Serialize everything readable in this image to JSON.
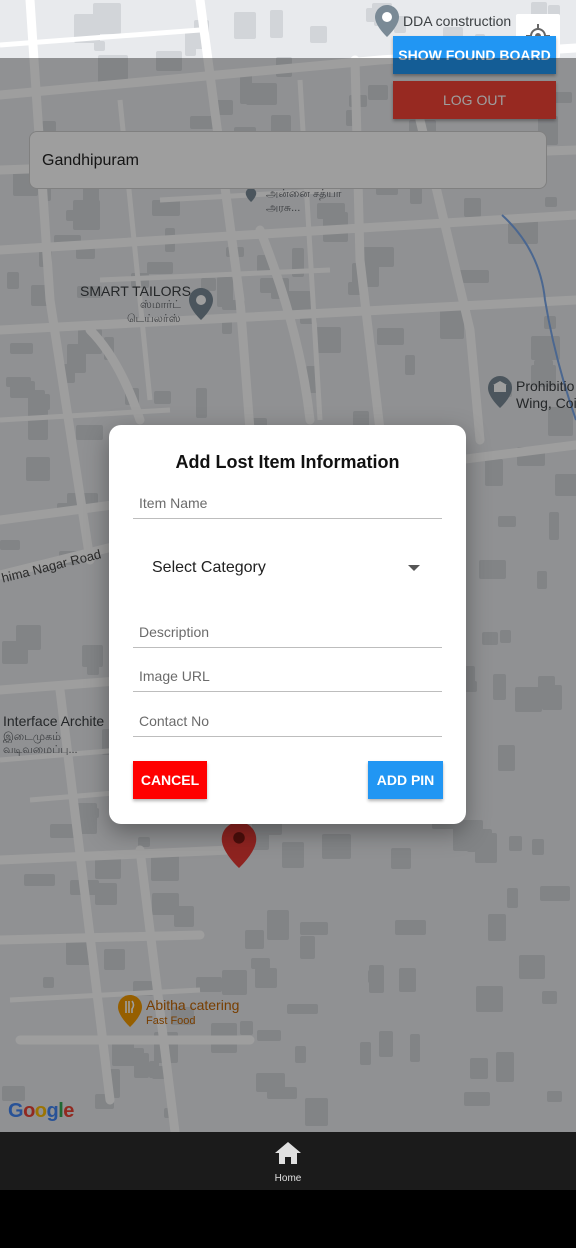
{
  "map": {
    "labels": {
      "dda": "DDA construction",
      "tamil_top": "அன்னை சத்யா",
      "tamil_top_sub": "அரசு...",
      "smart_tailors": "SMART TAILORS",
      "smart_tailors_tamil": "ஸ்மார்ட்",
      "smart_tailors_tamil2": "டெய்லர்ஸ்",
      "prohibition": "Prohibitio",
      "prohibition2": "Wing, Coi",
      "road": "hima Nagar Road",
      "interface": "Interface Archite",
      "interface_tamil": "இடைமுகம்",
      "interface_tamil2": "வடிவமைப்பு...",
      "abitha": "Abitha catering",
      "abitha_sub": "Fast Food"
    },
    "google_logo": [
      "G",
      "o",
      "o",
      "g",
      "l",
      "e"
    ],
    "logo_colors": [
      "#4285f4",
      "#ea4335",
      "#fbbc05",
      "#4285f4",
      "#34a853",
      "#ea4335"
    ]
  },
  "top_buttons": {
    "found_label": "SHOW FOUND BOARD",
    "logout_label": "LOG OUT"
  },
  "search": {
    "value": "Gandhipuram"
  },
  "dialog": {
    "title": "Add Lost Item Information",
    "item_name_placeholder": "Item Name",
    "category_label": "Select Category",
    "description_placeholder": "Description",
    "image_url_placeholder": "Image URL",
    "contact_placeholder": "Contact No",
    "cancel_label": "CANCEL",
    "add_label": "ADD PIN"
  },
  "bottom_nav": {
    "home_label": "Home"
  },
  "colors": {
    "primary": "#2196f3",
    "danger": "#f44336",
    "cancel": "#ff0000",
    "pin": "#c5221f"
  }
}
